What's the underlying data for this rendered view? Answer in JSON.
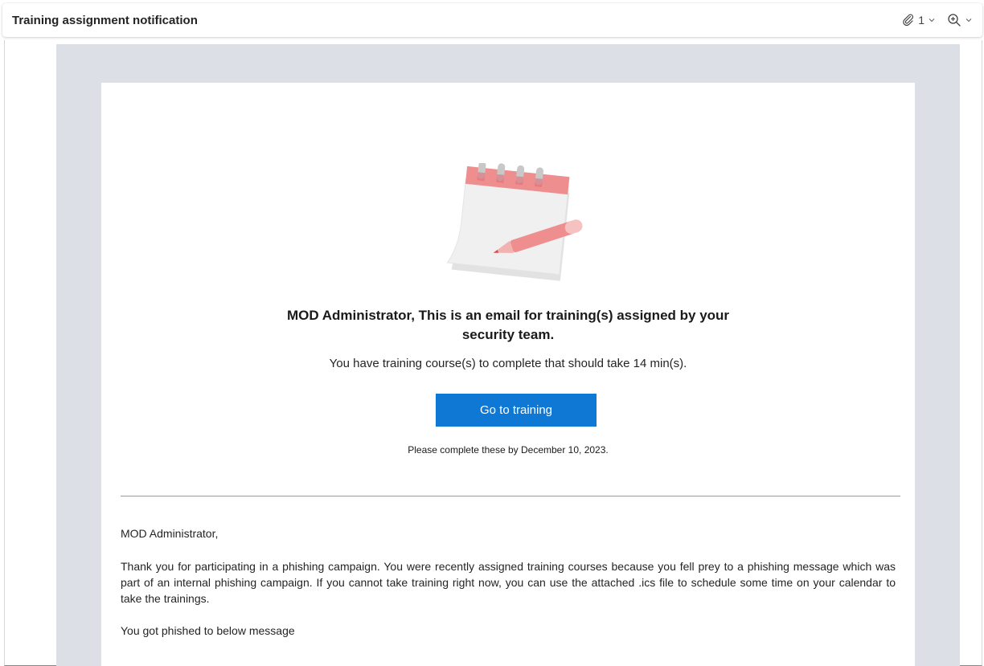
{
  "email": {
    "subject": "Training assignment notification",
    "attachment_count": "1"
  },
  "content": {
    "headline": "MOD Administrator, This is an email for training(s) assigned by your security team.",
    "subline": "You have training course(s) to complete that should take 14 min(s).",
    "cta_label": "Go to training",
    "due_text": "Please complete these by December 10, 2023.",
    "greeting": "MOD Administrator,",
    "paragraph": "Thank you for participating in a phishing campaign. You were recently assigned training courses because you fell prey to a phishing message which was part of an internal phishing campaign. If you cannot take training right now, you can use the attached .ics file to schedule some time on your calendar to take the trainings.",
    "phished_line": "You got phished to below message"
  },
  "colors": {
    "accent": "#0f78d4",
    "frame": "#dcdfe6",
    "illustration_red": "#ef8e8e"
  },
  "icons": [
    "paperclip-icon",
    "chevron-down-icon",
    "zoom-icon",
    "notepad-pencil-illustration"
  ]
}
